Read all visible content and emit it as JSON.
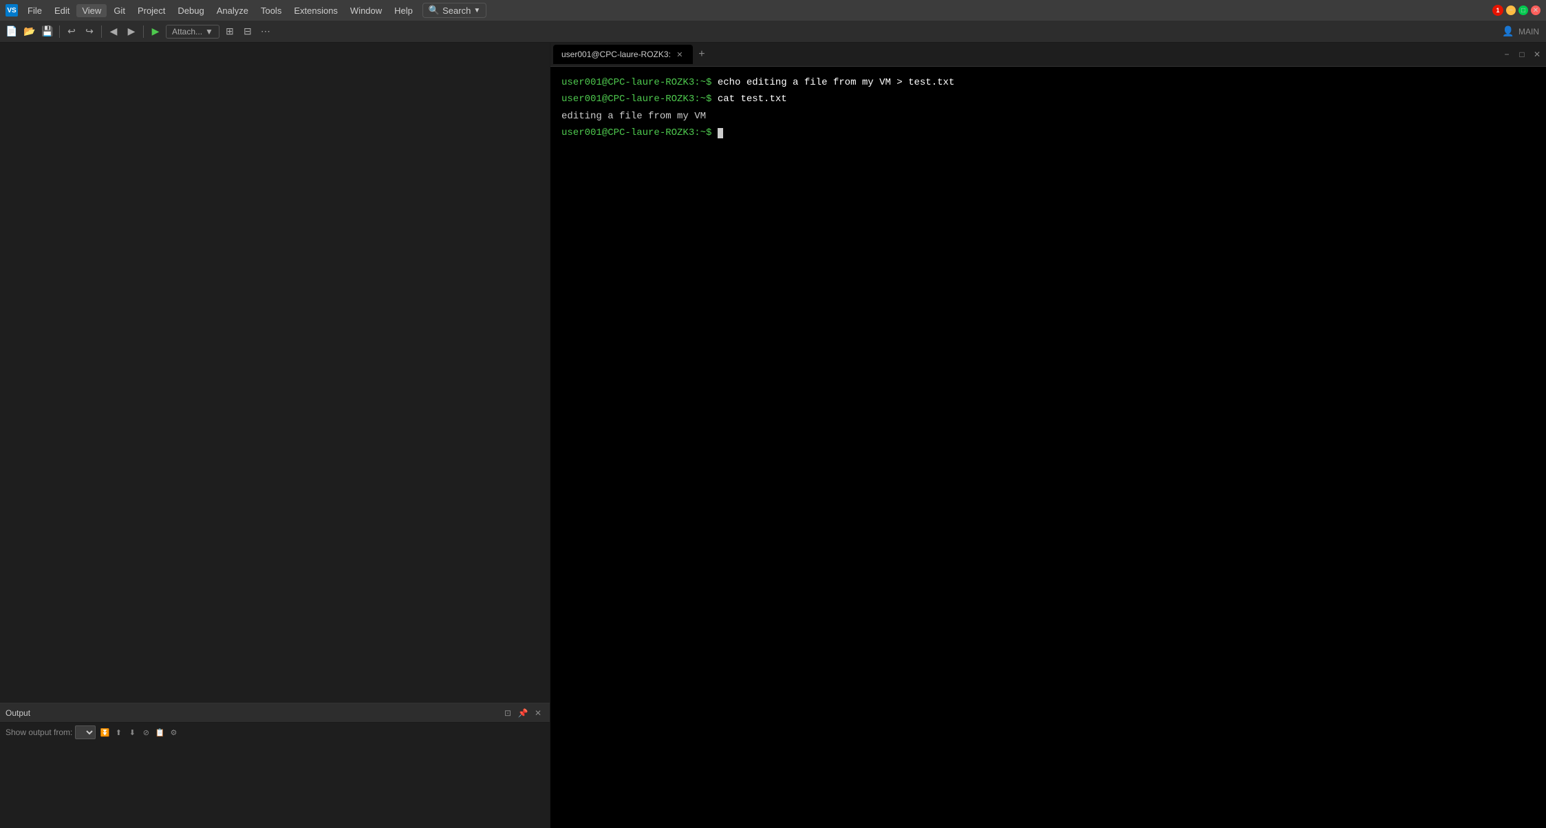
{
  "app": {
    "title": "Visual Studio",
    "icon_label": "VS"
  },
  "menu": {
    "items": [
      {
        "id": "file",
        "label": "File"
      },
      {
        "id": "edit",
        "label": "Edit"
      },
      {
        "id": "view",
        "label": "View"
      },
      {
        "id": "git",
        "label": "Git"
      },
      {
        "id": "project",
        "label": "Project"
      },
      {
        "id": "debug",
        "label": "Debug"
      },
      {
        "id": "analyze",
        "label": "Analyze"
      },
      {
        "id": "tools",
        "label": "Tools"
      },
      {
        "id": "extensions",
        "label": "Extensions"
      },
      {
        "id": "window",
        "label": "Window"
      },
      {
        "id": "help",
        "label": "Help"
      }
    ]
  },
  "search": {
    "label": "Search",
    "placeholder": "Search"
  },
  "toolbar": {
    "attach_label": "Attach...",
    "main_label": "MAIN",
    "notification_count": "1"
  },
  "output_panel": {
    "title": "Output",
    "show_output_from_label": "Show output from:"
  },
  "terminal": {
    "tab_label": "user001@CPC-laure-ROZK3:",
    "lines": [
      {
        "prompt": "user001@CPC-laure-ROZK3:~$",
        "command": " echo editing a file from my VM > test.txt"
      },
      {
        "prompt": "user001@CPC-laure-ROZK3:~$",
        "command": " cat test.txt"
      },
      {
        "output": "editing a file from my VM"
      },
      {
        "prompt": "user001@CPC-laure-ROZK3:~$",
        "command": "",
        "cursor": true
      }
    ]
  }
}
